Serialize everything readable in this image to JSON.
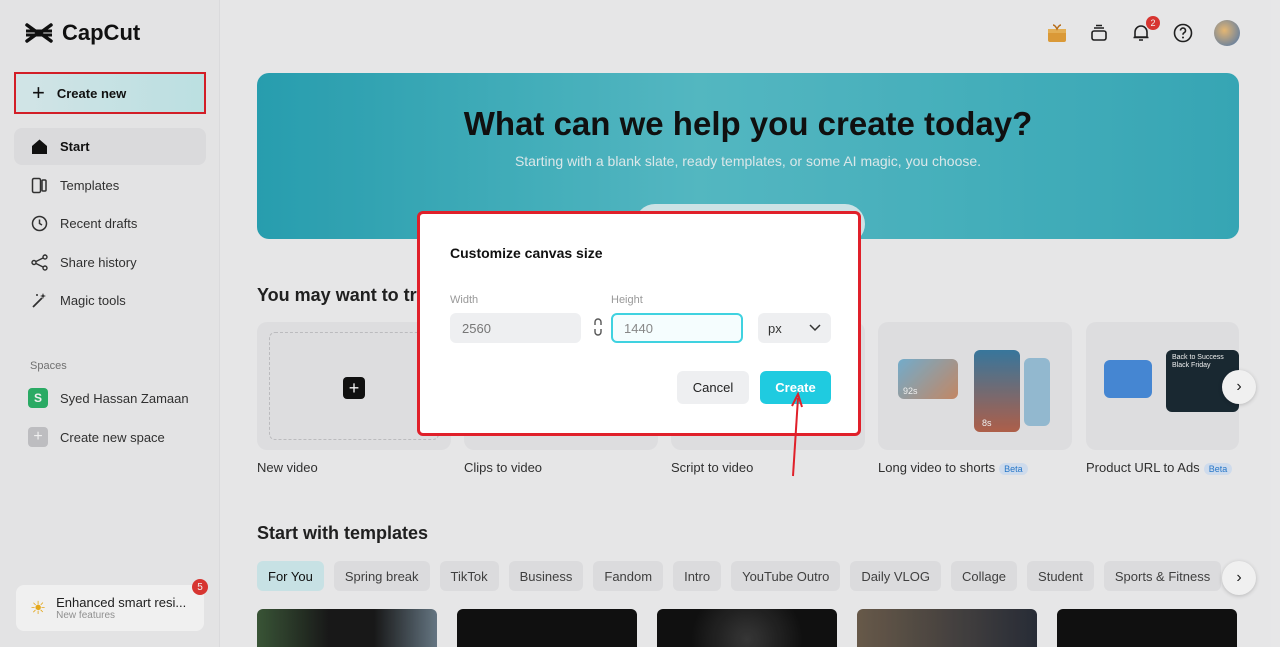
{
  "app": {
    "name": "CapCut"
  },
  "sidebar": {
    "create_new_label": "Create new",
    "items": [
      {
        "label": "Start",
        "icon": "home-icon",
        "active": true
      },
      {
        "label": "Templates",
        "icon": "templates-icon"
      },
      {
        "label": "Recent drafts",
        "icon": "clock-icon"
      },
      {
        "label": "Share history",
        "icon": "share-icon"
      },
      {
        "label": "Magic tools",
        "icon": "magic-wand-icon"
      }
    ],
    "spaces_label": "Spaces",
    "spaces": [
      {
        "label": "Syed Hassan Zamaan",
        "initial": "S"
      },
      {
        "label": "Create new space"
      }
    ],
    "feature_card": {
      "title": "Enhanced smart resi...",
      "subtitle": "New features",
      "badge": "5"
    }
  },
  "topbar": {
    "notification_count": "2"
  },
  "hero": {
    "title": "What can we help you create today?",
    "subtitle": "Starting with a blank slate, ready templates, or some AI magic, you choose."
  },
  "try_section": {
    "title": "You may want to try",
    "cards": [
      {
        "label": "New video"
      },
      {
        "label": "Clips to video"
      },
      {
        "label": "Script to video"
      },
      {
        "label": "Long video to shorts",
        "beta": "Beta",
        "thumb_text_1": "92s",
        "thumb_text_2": "8s"
      },
      {
        "label": "Product URL to Ads",
        "beta": "Beta",
        "thumb_text": "Back to Success Black Friday"
      }
    ]
  },
  "templates_section": {
    "title": "Start with templates",
    "chips": [
      "For You",
      "Spring break",
      "TikTok",
      "Business",
      "Fandom",
      "Intro",
      "YouTube Outro",
      "Daily VLOG",
      "Collage",
      "Student",
      "Sports & Fitness"
    ]
  },
  "dialog": {
    "title": "Customize canvas size",
    "width_label": "Width",
    "width_value": "2560",
    "height_label": "Height",
    "height_value": "1440",
    "unit": "px",
    "cancel_label": "Cancel",
    "create_label": "Create"
  },
  "colors": {
    "accent": "#1fcbe0",
    "annotation": "#e0202a",
    "badge": "#e53935"
  }
}
